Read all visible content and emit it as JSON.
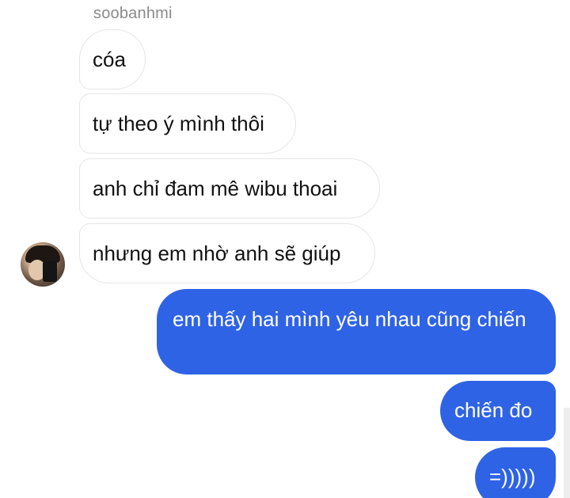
{
  "conversation": {
    "sender_name": "soobanhmi",
    "incoming_messages": [
      {
        "text": "cóa"
      },
      {
        "text": "tự theo ý mình thôi"
      },
      {
        "text": "anh chỉ đam mê wibu thoai"
      },
      {
        "text": "nhưng em nhờ anh sẽ giúp"
      }
    ],
    "outgoing_messages": [
      {
        "text": "em thấy hai mình yêu nhau cũng chiến"
      },
      {
        "text": "chiến đo"
      },
      {
        "text": "=)))))"
      }
    ]
  },
  "colors": {
    "outgoing_bubble": "#2f63e6",
    "incoming_bubble": "#ffffff",
    "incoming_border": "#e6e6e6",
    "sender_name": "#8a8a8a",
    "text_dark": "#111111",
    "text_light": "#ffffff"
  }
}
